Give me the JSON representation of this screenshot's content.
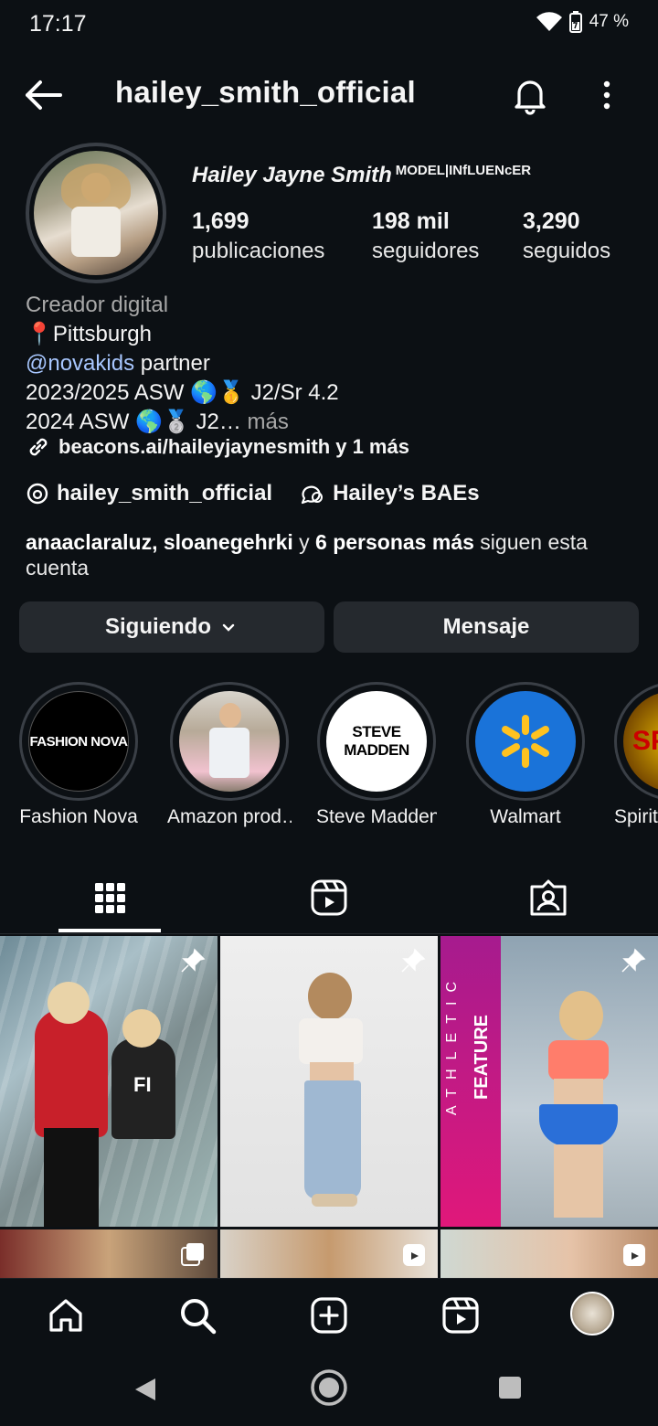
{
  "status": {
    "time": "17:17",
    "battery": "47 %"
  },
  "header": {
    "username": "hailey_smith_official"
  },
  "profile": {
    "display_name": "Hailey Jayne Smith",
    "tagline": "MODEL|INfLUENcER",
    "posts": {
      "count": "1,699",
      "label": "publicaciones"
    },
    "followers": {
      "count": "198 mil",
      "label": "seguidores"
    },
    "following": {
      "count": "3,290",
      "label": "seguidos"
    },
    "category": "Creador digital",
    "location": "📍Pittsburgh",
    "mention": "@novakids",
    "mention_suffix": " partner",
    "bio_line3": "2023/2025 ASW 🌎🥇 J2/Sr 4.2",
    "bio_line4": "2024 ASW 🌎🥈 J2…",
    "more": " más",
    "link": "beacons.ai/haileyjaynesmith y 1 más",
    "threads": "hailey_smith_official",
    "channel": "Hailey’s BAEs",
    "followed_by_names": "anaaclaraluz, sloanegehrki",
    "followed_by_mid": " y ",
    "followed_by_count": "6 personas más",
    "followed_by_tail": " siguen esta cuenta"
  },
  "buttons": {
    "following": "Siguiendo",
    "message": "Mensaje"
  },
  "highlights": [
    {
      "label": "Fashion Nova",
      "logo": "FASHION NOVA"
    },
    {
      "label": "Amazon prod…",
      "logo": ""
    },
    {
      "label": "Steve Madden",
      "logo": "STEVE MADDEN"
    },
    {
      "label": "Walmart",
      "logo": "walmart-spark"
    },
    {
      "label": "Spirit",
      "logo": "SP"
    }
  ],
  "grid": {
    "post_texts": [
      "FI",
      "ATHLETIC",
      "FEATURE"
    ]
  },
  "colors": {
    "background": "#0c1014",
    "button": "#25292e",
    "mention": "#a8c7ff",
    "walmart": "#1a73d9",
    "walmart_spark": "#ffc220"
  }
}
